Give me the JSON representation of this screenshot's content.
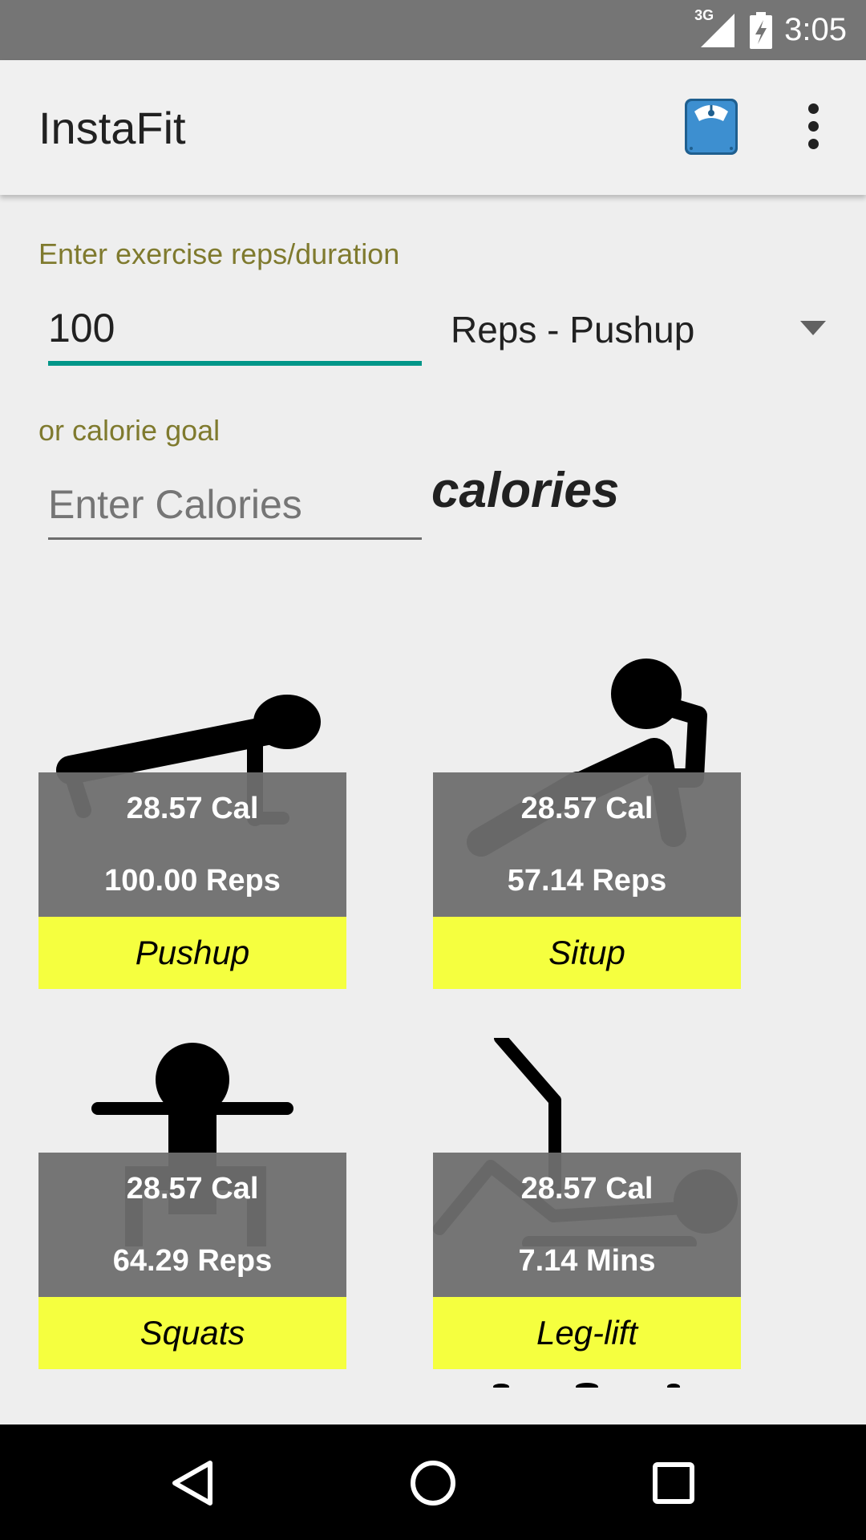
{
  "status_bar": {
    "network": "3G",
    "time": "3:05"
  },
  "app_bar": {
    "title": "InstaFit",
    "icons": [
      "scale-icon",
      "more-vert-icon"
    ]
  },
  "form": {
    "reps_label": "Enter exercise reps/duration",
    "reps_value": "100",
    "exercise_selected": "Reps - Pushup",
    "calorie_label": "or calorie goal",
    "calorie_placeholder": "Enter Calories",
    "calories_unit": "calories",
    "accent_color": "#009688"
  },
  "exercises": [
    {
      "name": "Pushup",
      "calories": "28.57 Cal",
      "amount": "100.00 Reps",
      "icon": "pushup-figure-icon"
    },
    {
      "name": "Situp",
      "calories": "28.57 Cal",
      "amount": "57.14 Reps",
      "icon": "situp-figure-icon"
    },
    {
      "name": "Squats",
      "calories": "28.57 Cal",
      "amount": "64.29 Reps",
      "icon": "squats-figure-icon"
    },
    {
      "name": "Leg-lift",
      "calories": "28.57 Cal",
      "amount": "7.14 Mins",
      "icon": "leg-lift-figure-icon"
    }
  ],
  "colors": {
    "label_color": "#7f7a2e",
    "name_bar": "#f5ff3f",
    "stats_bg": "#6e6e6e"
  },
  "nav_bar": {
    "icons": [
      "back-icon",
      "home-icon",
      "recents-icon"
    ]
  }
}
